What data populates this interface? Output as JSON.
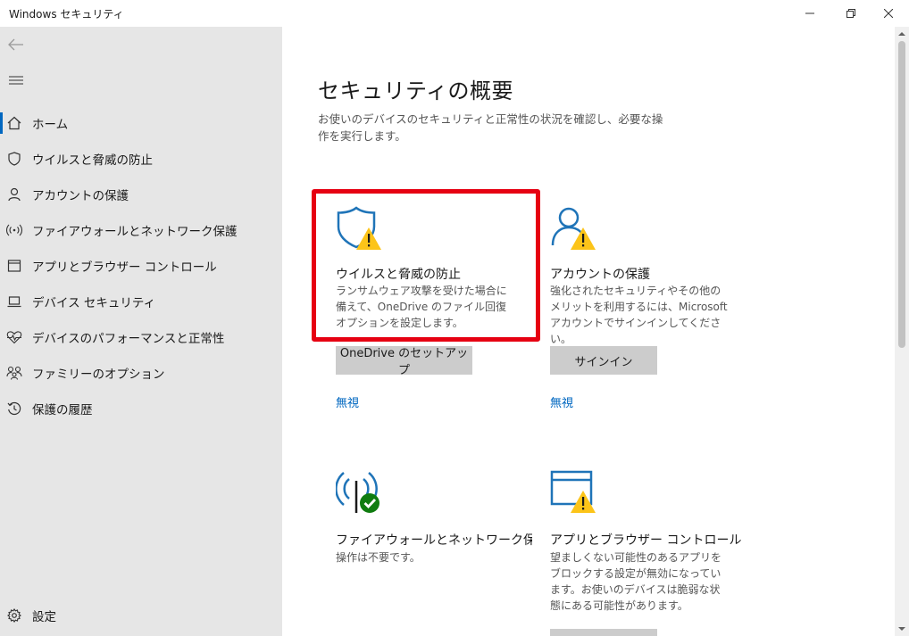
{
  "window": {
    "title": "Windows セキュリティ"
  },
  "sidebar": {
    "items": [
      {
        "label": "ホーム",
        "icon": "home-icon",
        "active": true
      },
      {
        "label": "ウイルスと脅威の防止",
        "icon": "shield-icon"
      },
      {
        "label": "アカウントの保護",
        "icon": "person-icon"
      },
      {
        "label": "ファイアウォールとネットワーク保護",
        "icon": "wifi-antenna-icon"
      },
      {
        "label": "アプリとブラウザー コントロール",
        "icon": "browser-window-icon"
      },
      {
        "label": "デバイス セキュリティ",
        "icon": "laptop-icon"
      },
      {
        "label": "デバイスのパフォーマンスと正常性",
        "icon": "heart-pulse-icon"
      },
      {
        "label": "ファミリーのオプション",
        "icon": "family-icon"
      },
      {
        "label": "保護の履歴",
        "icon": "history-icon"
      }
    ],
    "settings": {
      "label": "設定",
      "icon": "gear-icon"
    }
  },
  "main": {
    "title": "セキュリティの概要",
    "description": "お使いのデバイスのセキュリティと正常性の状況を確認し、必要な操作を実行します。",
    "cards": [
      {
        "title": "ウイルスと脅威の防止",
        "description": "ランサムウェア攻撃を受けた場合に備えて、OneDrive のファイル回復オプションを設定します。",
        "button": "OneDrive のセットアップ",
        "link": "無視",
        "status": "warning"
      },
      {
        "title": "アカウントの保護",
        "description": "強化されたセキュリティやその他のメリットを利用するには、Microsoft アカウントでサインインしてください。",
        "button": "サインイン",
        "link": "無視",
        "status": "warning"
      },
      {
        "title": "ファイアウォールとネットワーク保護",
        "description": "操作は不要です。",
        "status": "ok"
      },
      {
        "title": "アプリとブラウザー コントロール",
        "description": "望ましくない可能性のあるアプリをブロックする設定が無効になっています。お使いのデバイスは脆弱な状態にある可能性があります。",
        "status": "warning"
      }
    ]
  },
  "colors": {
    "accent": "#0067c0",
    "warning": "#fcc419",
    "ok": "#107c10",
    "highlight": "#e60012",
    "icon_blue": "#1f74b8"
  }
}
